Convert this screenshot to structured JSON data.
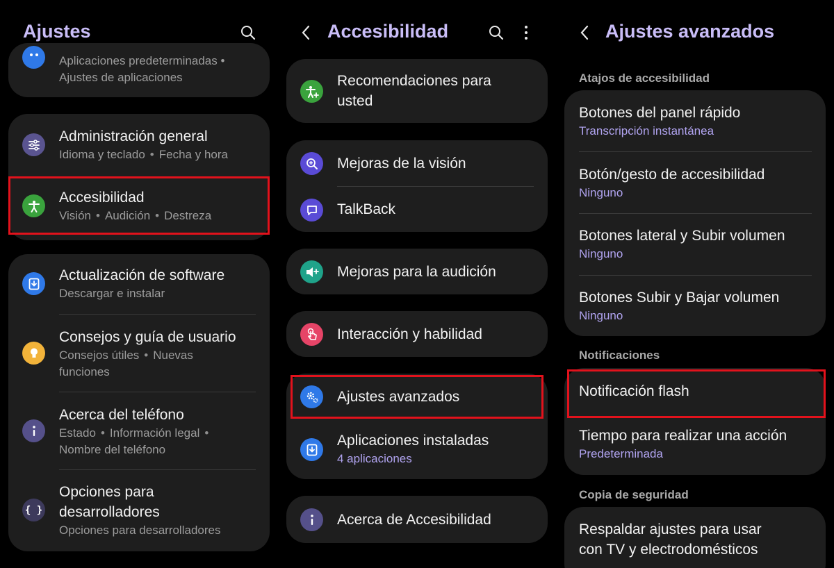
{
  "panel1": {
    "title": "Ajustes",
    "top_card": {
      "line1": "Aplicaciones predeterminadas  •",
      "line2": "Ajustes de aplicaciones"
    },
    "general": {
      "title": "Administración general",
      "sub1": "Idioma y teclado",
      "sub2": "Fecha y hora"
    },
    "accessibility": {
      "title": "Accesibilidad",
      "sub1": "Visión",
      "sub2": "Audición",
      "sub3": "Destreza"
    },
    "software": {
      "title": "Actualización de software",
      "sub": "Descargar e instalar"
    },
    "tips": {
      "title": "Consejos y guía de usuario",
      "sub1": "Consejos útiles",
      "sub2": "Nuevas",
      "sub3": "funciones"
    },
    "about": {
      "title": "Acerca del teléfono",
      "sub1": "Estado",
      "sub2": "Información legal",
      "sub3": "Nombre del teléfono"
    },
    "dev": {
      "title1": "Opciones para",
      "title2": "desarrolladores",
      "sub": "Opciones para desarrolladores"
    }
  },
  "panel2": {
    "title": "Accesibilidad",
    "items": {
      "recommend1": "Recomendaciones para",
      "recommend2": "usted",
      "vision": "Mejoras de la visión",
      "talkback": "TalkBack",
      "hearing": "Mejoras para la audición",
      "interaction": "Interacción y habilidad",
      "advanced": "Ajustes avanzados",
      "installed": "Aplicaciones instaladas",
      "installed_sub": "4 aplicaciones",
      "about": "Acerca de Accesibilidad"
    }
  },
  "panel3": {
    "title": "Ajustes avanzados",
    "section_shortcuts": "Atajos de accesibilidad",
    "quick_panel": {
      "title": "Botones del panel rápido",
      "sub": "Transcripción instantánea"
    },
    "gesture": {
      "title": "Botón/gesto de accesibilidad",
      "sub": "Ninguno"
    },
    "side_vol": {
      "title": "Botones lateral y Subir volumen",
      "sub": "Ninguno"
    },
    "vol_up_down": {
      "title": "Botones Subir y Bajar volumen",
      "sub": "Ninguno"
    },
    "section_notifications": "Notificaciones",
    "flash": {
      "title": "Notificación flash"
    },
    "action_time": {
      "title": "Tiempo para realizar una acción",
      "sub": "Predeterminada"
    },
    "section_backup": "Copia de seguridad",
    "backup": {
      "title1": "Respaldar ajustes para usar",
      "title2": "con TV y electrodomésticos"
    }
  },
  "colors": {
    "title": "#c9bdf7",
    "accent_sub": "#b0a3ef",
    "highlight": "#e2121c",
    "card": "#1e1e1e",
    "icon_general": "#5a5490",
    "icon_access": "#3aa33d",
    "icon_software": "#2f79e8",
    "icon_tips": "#f2b33a",
    "icon_about": "#55508a",
    "icon_dev": "#3d3a5c",
    "icon_recommend": "#3aa33d",
    "icon_vision": "#5a4bd6",
    "icon_talkback": "#5a4bd6",
    "icon_hearing": "#1fa38a",
    "icon_interaction": "#e64467",
    "icon_advanced": "#2f79e8",
    "icon_installed": "#2f79e8",
    "icon_info": "#55508a"
  },
  "icons": {
    "search": "search-icon",
    "back": "back-arrow-icon",
    "more": "more-vertical-icon",
    "general": "sliders-icon",
    "accessibility": "accessibility-person-icon",
    "software": "software-update-icon",
    "tips": "lightbulb-icon",
    "about": "info-icon",
    "dev": "code-braces-icon",
    "recommend": "person-plus-icon",
    "vision": "magnifier-plus-icon",
    "talkback": "speech-bubble-icon",
    "hearing": "speaker-plus-icon",
    "interaction": "hand-touch-icon",
    "advanced": "gears-icon",
    "installed": "download-box-icon"
  }
}
